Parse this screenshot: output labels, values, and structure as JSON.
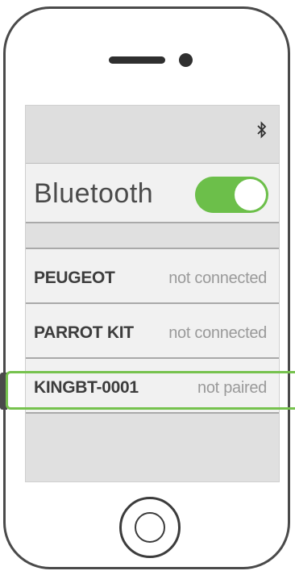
{
  "status_bar": {
    "icon": "bluetooth-icon"
  },
  "bluetooth": {
    "label": "Bluetooth",
    "enabled": true,
    "toggle_color": "#6cbf4a"
  },
  "devices": [
    {
      "name": "PEUGEOT",
      "status": "not connected"
    },
    {
      "name": "PARROT KIT",
      "status": "not connected"
    },
    {
      "name": "KINGBT-0001",
      "status": "not paired",
      "highlighted": true
    }
  ],
  "colors": {
    "highlight": "#76c24e",
    "device_status": "#9a9a9a"
  }
}
